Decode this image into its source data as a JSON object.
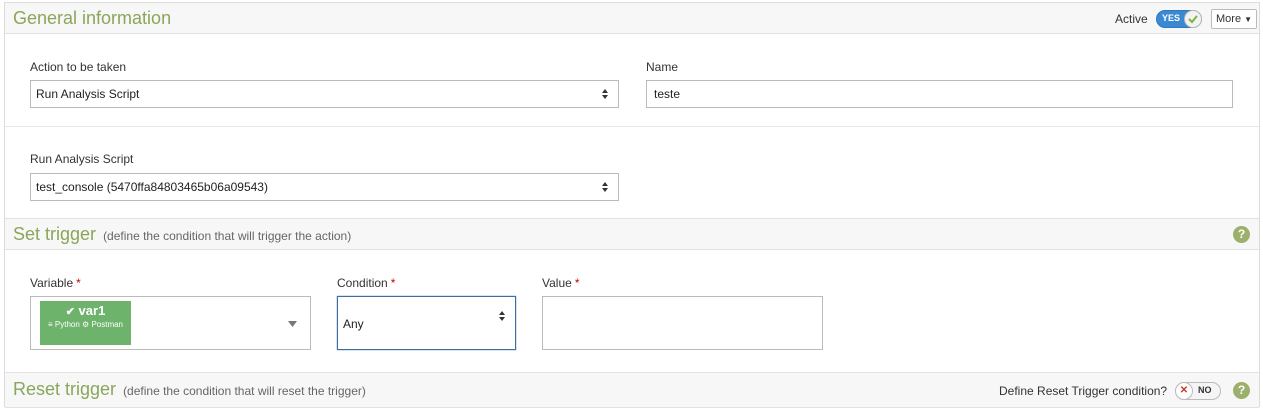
{
  "general": {
    "title": "General information",
    "active_label": "Active",
    "active_toggle": "YES",
    "more_label": "More",
    "action_label": "Action to be taken",
    "action_value": "Run Analysis Script",
    "name_label": "Name",
    "name_value": "teste",
    "script_label": "Run Analysis Script",
    "script_value": "test_console (5470ffa84803465b06a09543)"
  },
  "set_trigger": {
    "title": "Set trigger",
    "subtitle": "(define the condition that will trigger the action)",
    "help": "?",
    "variable_label": "Variable",
    "required_mark": "*",
    "variable": {
      "name": "var1",
      "tag1": "Python",
      "tag2": "Postman",
      "color": "#6db36b"
    },
    "condition_label": "Condition",
    "condition_value": "Any",
    "value_label": "Value",
    "value_value": ""
  },
  "reset_trigger": {
    "title": "Reset trigger",
    "subtitle": "(define the condition that will reset the trigger)",
    "define_label": "Define Reset Trigger condition?",
    "toggle": "NO",
    "help": "?"
  },
  "colors": {
    "accent": "#8aa65b",
    "toggle_on": "#3a8ad3",
    "close_x": "#c0392b"
  }
}
